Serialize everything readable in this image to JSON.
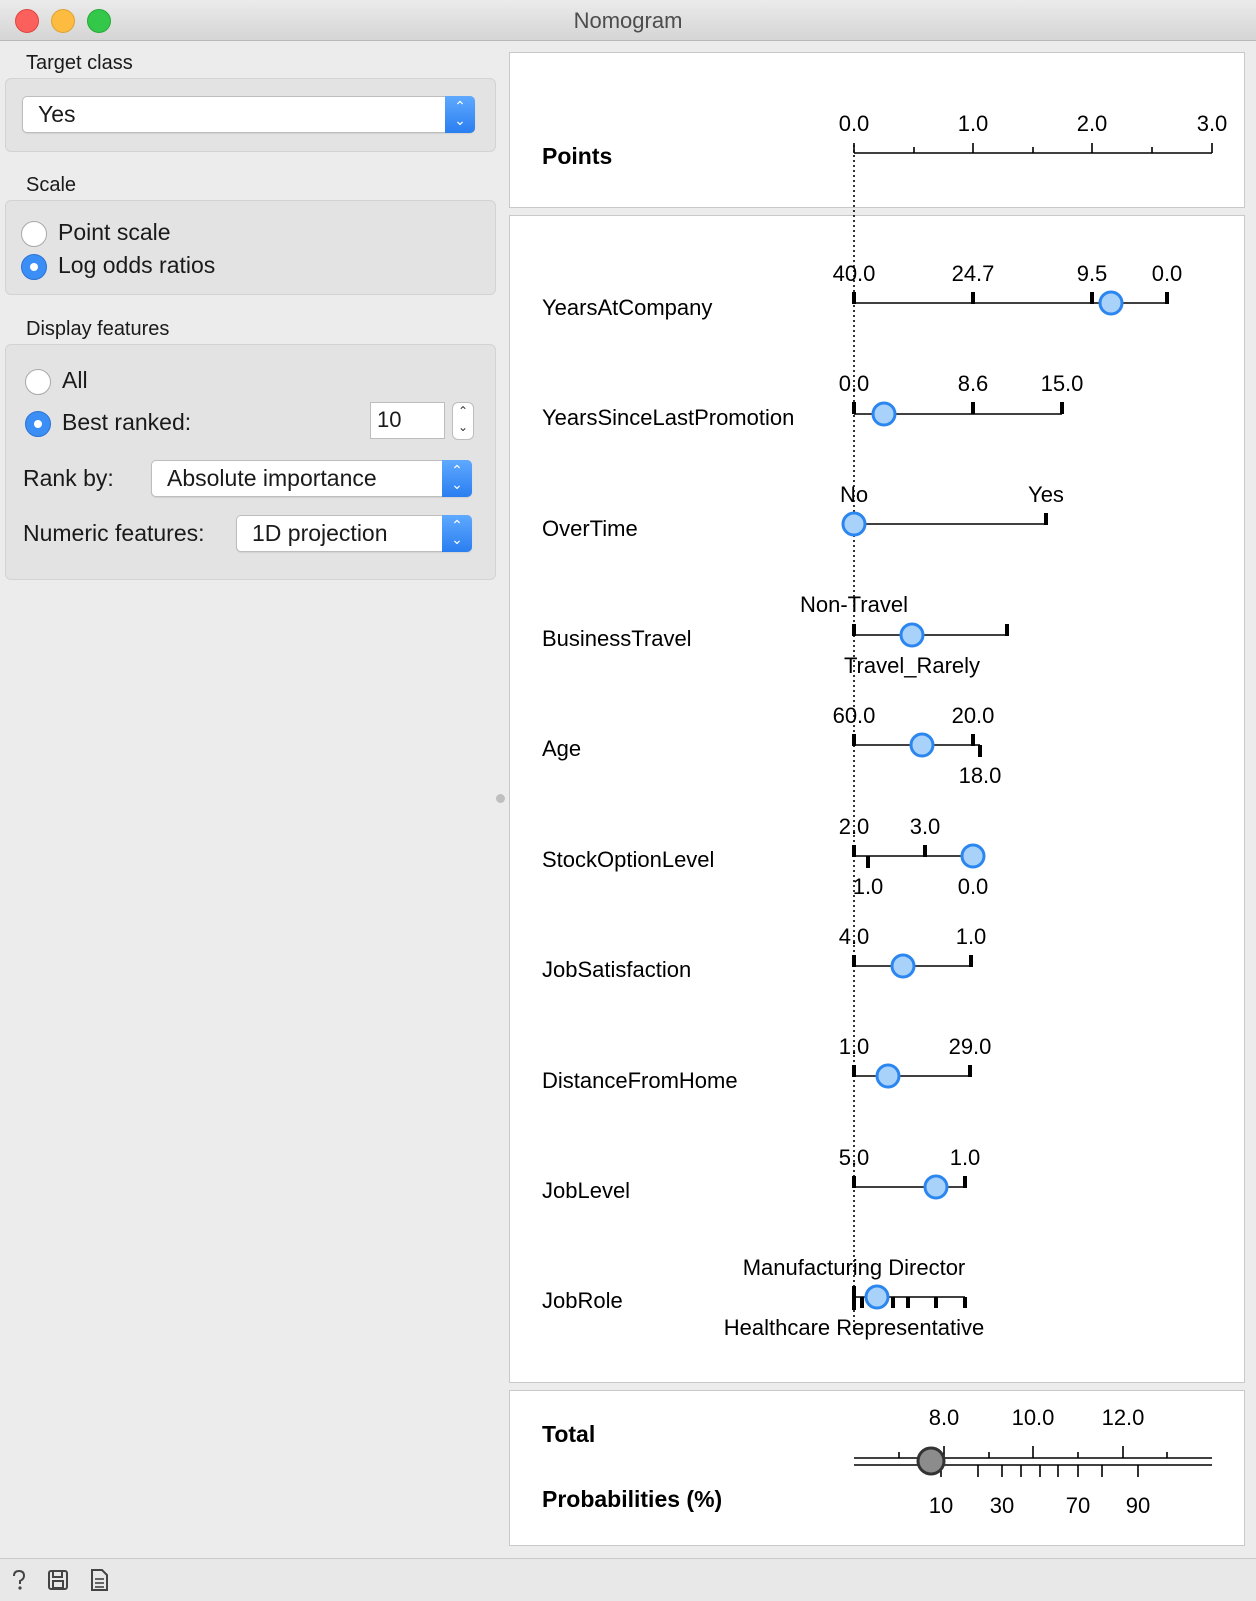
{
  "window": {
    "title": "Nomogram"
  },
  "controls": {
    "target_class": {
      "label": "Target class",
      "value": "Yes"
    },
    "scale": {
      "label": "Scale",
      "options": [
        {
          "label": "Point scale",
          "selected": false
        },
        {
          "label": "Log odds ratios",
          "selected": true
        }
      ]
    },
    "display": {
      "label": "Display features",
      "all_label": "All",
      "best_label": "Best ranked:",
      "best_value": "10",
      "rank_by_label": "Rank by:",
      "rank_by_value": "Absolute importance",
      "numeric_label": "Numeric features:",
      "numeric_value": "1D projection"
    }
  },
  "nomogram": {
    "points": {
      "label": "Points",
      "ticks": [
        "0.0",
        "1.0",
        "2.0",
        "3.0"
      ]
    },
    "features": [
      {
        "name": "YearsAtCompany",
        "labels_top": [
          "40.0",
          "24.7",
          "9.5",
          "0.0"
        ],
        "labels_bottom": []
      },
      {
        "name": "YearsSinceLastPromotion",
        "labels_top": [
          "0.0",
          "8.6",
          "15.0"
        ],
        "labels_bottom": []
      },
      {
        "name": "OverTime",
        "labels_top": [
          "No",
          "Yes"
        ],
        "labels_bottom": []
      },
      {
        "name": "BusinessTravel",
        "labels_top": [
          "Non-Travel"
        ],
        "labels_bottom": [
          "Travel_Rarely"
        ]
      },
      {
        "name": "Age",
        "labels_top": [
          "60.0",
          "20.0"
        ],
        "labels_bottom": [
          "18.0"
        ]
      },
      {
        "name": "StockOptionLevel",
        "labels_top": [
          "2.0",
          "3.0"
        ],
        "labels_bottom": [
          "1.0",
          "0.0"
        ]
      },
      {
        "name": "JobSatisfaction",
        "labels_top": [
          "4.0",
          "1.0"
        ],
        "labels_bottom": []
      },
      {
        "name": "DistanceFromHome",
        "labels_top": [
          "1.0",
          "29.0"
        ],
        "labels_bottom": []
      },
      {
        "name": "JobLevel",
        "labels_top": [
          "5.0",
          "1.0"
        ],
        "labels_bottom": []
      },
      {
        "name": "JobRole",
        "labels_top": [
          "Manufacturing Director"
        ],
        "labels_bottom": [
          "Healthcare Representative"
        ]
      }
    ],
    "total": {
      "label": "Total",
      "ticks": [
        "8.0",
        "10.0",
        "12.0"
      ]
    },
    "probabilities": {
      "label": "Probabilities (%)",
      "ticks": [
        "10",
        "30",
        "70",
        "90"
      ]
    }
  },
  "status_icons": [
    "help-icon",
    "save-icon",
    "report-icon"
  ]
}
